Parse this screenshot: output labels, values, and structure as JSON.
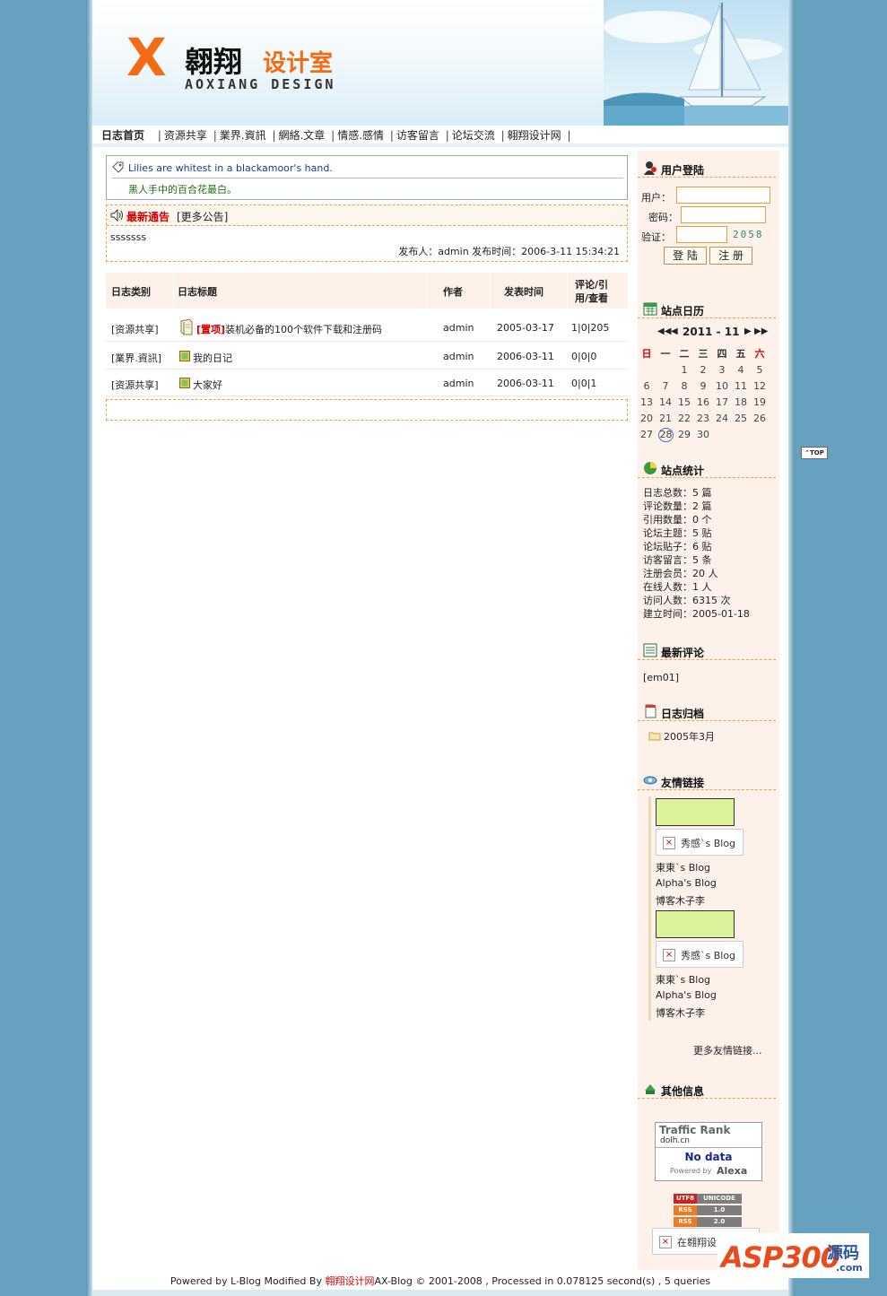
{
  "header": {
    "logo_mark": "X",
    "logo_cn_a": "翱翔",
    "logo_cn_b": "设计室",
    "logo_en": "AOXIANG DESIGN"
  },
  "nav": {
    "home": "日志首页",
    "items": [
      "资源共享",
      "業界.資訊",
      "網絡.文章",
      "情感.感情",
      "访客留言",
      "论坛交流",
      "翱翔设计网"
    ]
  },
  "quote": {
    "en": "Lilies are whitest in a blackamoor's hand.",
    "cn": "黑人手中的百合花最白。"
  },
  "announcement": {
    "title": "最新通告",
    "more": "[更多公告]",
    "body": "sssssss",
    "meta": "发布人：admin 发布时间：2006-3-11 15:34:21"
  },
  "table": {
    "headers": [
      "日志类别",
      "日志标题",
      "作者",
      "发表时间",
      "评论/引",
      "用/查看"
    ],
    "rows": [
      {
        "category": "[资源共享]",
        "pin": "[置项]",
        "title": "装机必备的100个软件下载和注册码",
        "author": "admin",
        "date": "2005-03-17",
        "stats": "1|0|205"
      },
      {
        "category": "[業界.資訊]",
        "pin": "",
        "title": "我的日记",
        "author": "admin",
        "date": "2006-03-11",
        "stats": "0|0|0"
      },
      {
        "category": "[资源共享]",
        "pin": "",
        "title": "大家好",
        "author": "admin",
        "date": "2006-03-11",
        "stats": "0|0|1"
      }
    ]
  },
  "login": {
    "title": "用户登陆",
    "user_label": "用户：",
    "pass_label": "密码：",
    "verify_label": "验证：",
    "verify_code": "2058",
    "login_btn": "登 陆",
    "register_btn": "注 册"
  },
  "calendar": {
    "title": "站点日历",
    "month": "2011 - 11",
    "weekdays": [
      "日",
      "一",
      "二",
      "三",
      "四",
      "五",
      "六"
    ],
    "weeks": [
      [
        "",
        "",
        "1",
        "2",
        "3",
        "4",
        "5"
      ],
      [
        "6",
        "7",
        "8",
        "9",
        "10",
        "11",
        "12"
      ],
      [
        "13",
        "14",
        "15",
        "16",
        "17",
        "18",
        "19"
      ],
      [
        "20",
        "21",
        "22",
        "23",
        "24",
        "25",
        "26"
      ],
      [
        "27",
        "28",
        "29",
        "30",
        "",
        "",
        ""
      ]
    ],
    "today": "28"
  },
  "stats": {
    "title": "站点统计",
    "lines": [
      "日志总数：5 篇",
      "评论数量：2 篇",
      "引用数量：0 个",
      "论坛主题：5 贴",
      "论坛贴子：6 贴",
      "访客留言：5 条",
      "注册会员：20 人",
      "在线人数：1 人",
      "访问人数：6315 次",
      "建立时间：2005-01-18"
    ]
  },
  "comments": {
    "title": "最新评论",
    "items": [
      "[em01]"
    ]
  },
  "archive": {
    "title": "日志归档",
    "items": [
      "2005年3月"
    ]
  },
  "links": {
    "title": "友情链接",
    "image_link": "秀感`s Blog",
    "text_links": [
      "東東`s Blog",
      "Alpha's Blog",
      "博客木子李"
    ],
    "more": "更多友情链接..."
  },
  "other": {
    "title": "其他信息",
    "rank_title": "Traffic Rank",
    "rank_site": "dolh.cn",
    "rank_value": "No data",
    "rank_powered": "Powered by",
    "rank_brand": "Alexa",
    "badges": [
      {
        "a": "UTF8",
        "b": "UNICODE"
      },
      {
        "a": "RSS",
        "b": "1.0"
      },
      {
        "a": "RSS",
        "b": "2.0"
      }
    ],
    "broken_text": "在翱翔设"
  },
  "footer": {
    "pre": "Powered by L-Blog Modified By ",
    "brand": "翱翔设计网",
    "post": "AX-Blog © 2001-2008 , Processed in 0.078125 second(s) , 5 queries"
  },
  "top_button": "TOP",
  "watermark": {
    "a": "ASP300",
    "b": "源码",
    "c": ".com"
  },
  "colors": {
    "accent": "#f36b12",
    "pin": "#d40000",
    "background": "#66a2c0"
  }
}
